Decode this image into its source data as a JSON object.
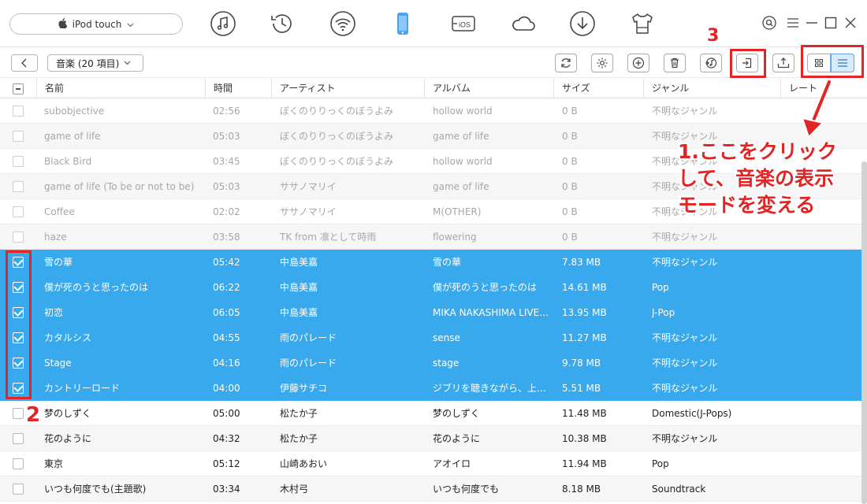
{
  "device": {
    "name": "iPod touch"
  },
  "nav_icons": [
    "music-icon",
    "history-icon",
    "wifi-icon",
    "phone-icon",
    "ios-icon",
    "cloud-icon",
    "download-icon",
    "shirt-icon"
  ],
  "nav_ios_label": "iOS",
  "toolbar": {
    "category": "音楽 (20 項目)"
  },
  "columns": [
    "名前",
    "時間",
    "アーティスト",
    "アルバム",
    "サイズ",
    "ジャンル",
    "レート"
  ],
  "rows": [
    {
      "name": "subobjective",
      "time": "02:56",
      "artist": "ぼくのりりっくのぼうよみ",
      "album": "hollow world",
      "size": "0 B",
      "genre": "不明なジャンル",
      "state": "dim"
    },
    {
      "name": "game of life",
      "time": "05:03",
      "artist": "ぼくのりりっくのぼうよみ",
      "album": "game of life",
      "size": "0 B",
      "genre": "不明なジャンル",
      "state": "dim"
    },
    {
      "name": "Black Bird",
      "time": "03:45",
      "artist": "ぼくのりりっくのぼうよみ",
      "album": "hollow world",
      "size": "0 B",
      "genre": "不明なジャンル",
      "state": "dim"
    },
    {
      "name": "game of life (To be or not to be)",
      "time": "05:03",
      "artist": "ササノマリイ",
      "album": "game of life",
      "size": "0 B",
      "genre": "不明なジャンル",
      "state": "dim"
    },
    {
      "name": "Coffee",
      "time": "02:02",
      "artist": "ササノマリイ",
      "album": "M(OTHER)",
      "size": "0 B",
      "genre": "不明なジャンル",
      "state": "dim"
    },
    {
      "name": "haze",
      "time": "03:58",
      "artist": "TK from 凛として時雨",
      "album": "flowering",
      "size": "0 B",
      "genre": "不明なジャンル",
      "state": "dim"
    },
    {
      "name": "雪の華",
      "time": "05:42",
      "artist": "中島美嘉",
      "album": "雪の華",
      "size": "7.83 MB",
      "genre": "不明なジャンル",
      "state": "selected"
    },
    {
      "name": "僕が死のうと思ったのは",
      "time": "06:22",
      "artist": "中島美嘉",
      "album": "僕が死のうと思ったのは",
      "size": "14.61 MB",
      "genre": "Pop",
      "state": "selected"
    },
    {
      "name": "初恋",
      "time": "06:05",
      "artist": "中島美嘉",
      "album": "MIKA NAKASHIMA LIVE I...",
      "size": "13.95 MB",
      "genre": "J-Pop",
      "state": "selected"
    },
    {
      "name": "カタルシス",
      "time": "04:55",
      "artist": "雨のパレード",
      "album": "sense",
      "size": "11.27 MB",
      "genre": "不明なジャンル",
      "state": "selected"
    },
    {
      "name": "Stage",
      "time": "04:16",
      "artist": "雨のパレード",
      "album": "stage",
      "size": "9.78 MB",
      "genre": "不明なジャンル",
      "state": "selected"
    },
    {
      "name": "カントリーロード",
      "time": "04:00",
      "artist": "伊藤サチコ",
      "album": "ジブリを聴きながら、上を向い...",
      "size": "5.51 MB",
      "genre": "不明なジャンル",
      "state": "selected"
    },
    {
      "name": "梦のしずく",
      "time": "05:00",
      "artist": "松たか子",
      "album": "梦のしずく",
      "size": "11.48 MB",
      "genre": "Domestic(J-Pops)",
      "state": "normal"
    },
    {
      "name": "花のように",
      "time": "04:32",
      "artist": "松たか子",
      "album": "花のように",
      "size": "10.38 MB",
      "genre": "不明なジャンル",
      "state": "normal"
    },
    {
      "name": "東京",
      "time": "05:12",
      "artist": "山崎あおい",
      "album": "アオイロ",
      "size": "11.94 MB",
      "genre": "Pop",
      "state": "normal"
    },
    {
      "name": "いつも何度でも(主題歌)",
      "time": "03:34",
      "artist": "木村弓",
      "album": "いつも何度でも",
      "size": "8.18 MB",
      "genre": "Soundtrack",
      "state": "normal"
    }
  ],
  "annotations": {
    "step1": "1.ここをクリック\nして、音楽の表示\nモードを変える",
    "step2": "2",
    "step3": "3"
  },
  "colors": {
    "selected_row": "#38a9ec",
    "annotation_red": "#e32424",
    "grid_active": "#d9ebff"
  }
}
